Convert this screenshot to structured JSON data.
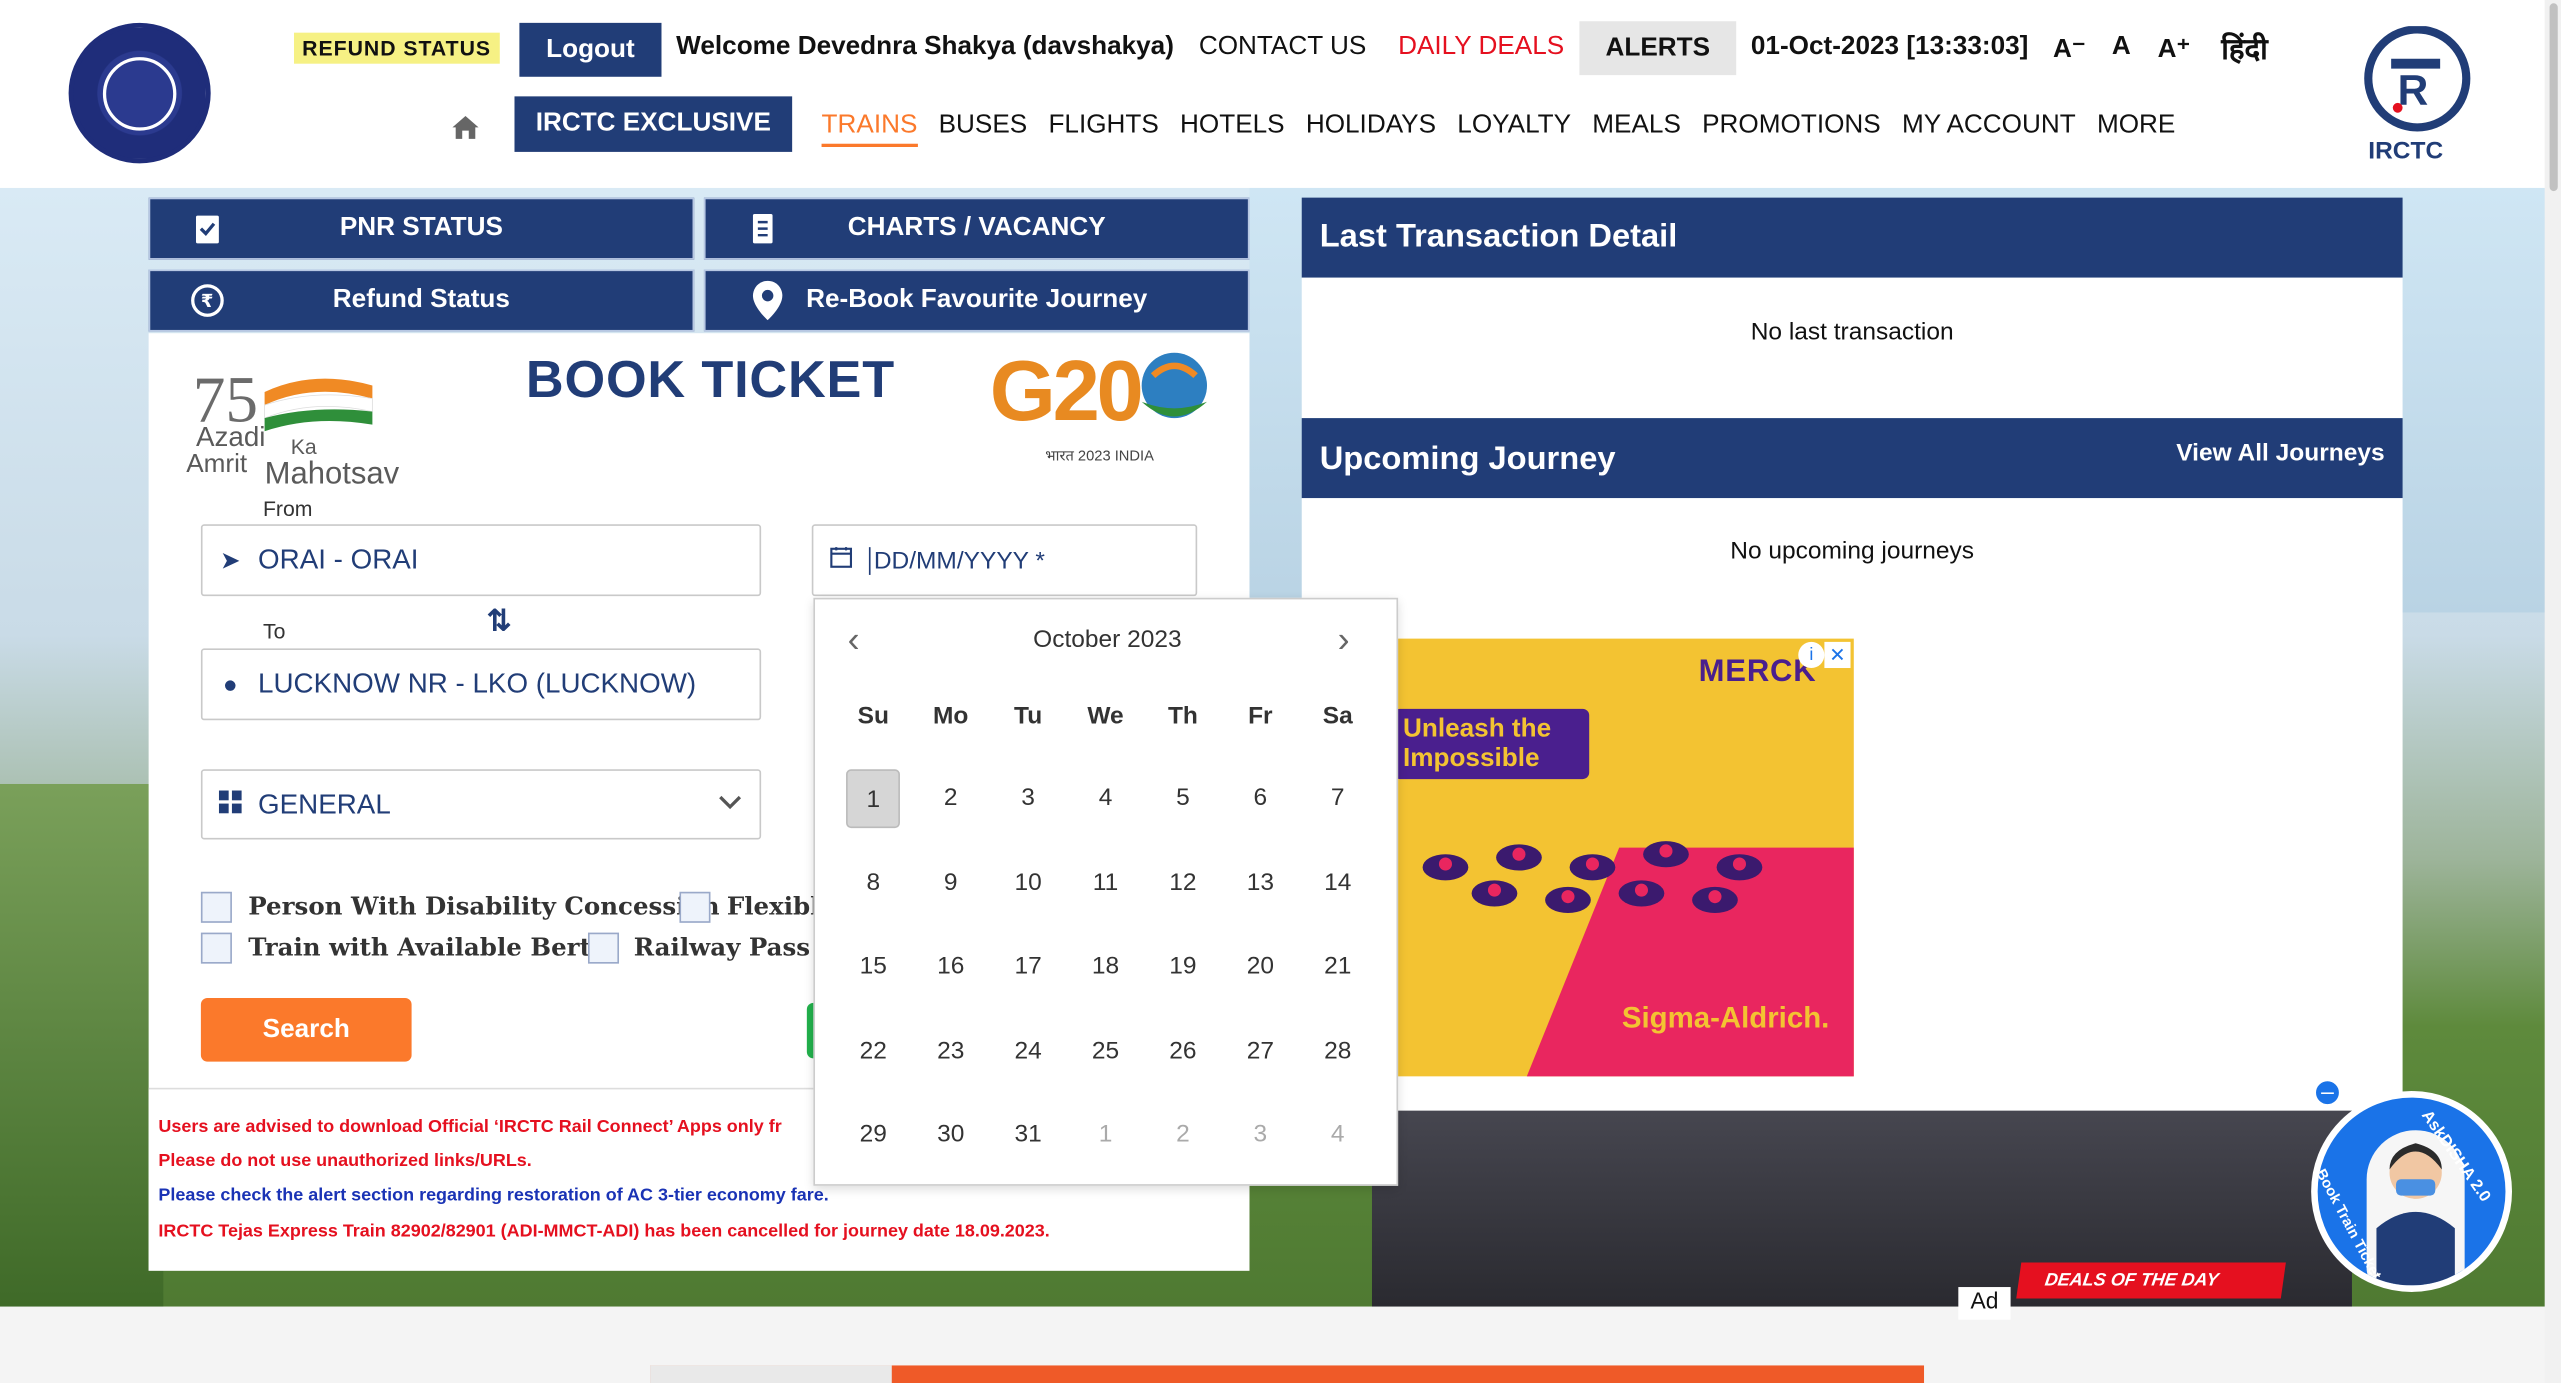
{
  "header": {
    "refund_badge": "REFUND STATUS",
    "logout": "Logout",
    "welcome": "Welcome Devednra Shakya (davshakya)",
    "contact": "CONTACT US",
    "daily_deals": "DAILY DEALS",
    "alerts": "ALERTS",
    "datetime": "01-Oct-2023 [13:33:03]",
    "font_small": "A⁻",
    "font_normal": "A",
    "font_large": "A⁺",
    "hindi": "हिंदी",
    "irctc_logo_text": "IRCTC",
    "exclusive": "IRCTC EXCLUSIVE",
    "nav": [
      "TRAINS",
      "BUSES",
      "FLIGHTS",
      "HOTELS",
      "HOLIDAYS",
      "LOYALTY",
      "MEALS",
      "PROMOTIONS",
      "MY ACCOUNT",
      "MORE"
    ]
  },
  "tiles": {
    "pnr": "PNR STATUS",
    "charts": "CHARTS / VACANCY",
    "refund": "Refund Status",
    "rebook": "Re-Book Favourite Journey"
  },
  "book": {
    "title": "BOOK TICKET",
    "from_label": "From",
    "from_value": "ORAI - ORAI",
    "to_label": "To",
    "to_value": "LUCKNOW NR - LKO (LUCKNOW)",
    "date_placeholder": "DD/MM/YYYY *",
    "quota": "GENERAL",
    "chk_disability": "Person With Disability Concession",
    "chk_flexible": "Flexible",
    "chk_berth": "Train with Available Berth",
    "chk_railpass": "Railway Pass Co",
    "search": "Search",
    "azadi_line1": "Azadi",
    "azadi_ka": "Ka",
    "azadi_line2": "Amrit",
    "azadi_mahotsav": "Mahotsav",
    "g20_text": "G20",
    "g20_sub": "भारत 2023 INDIA"
  },
  "notices": [
    {
      "text": "Users are advised to download Official ‘IRCTC Rail Connect’ Apps only fr",
      "color": "#e5101f"
    },
    {
      "text": "Please do not use unauthorized links/URLs.",
      "color": "#e5101f"
    },
    {
      "text": "Please check the alert section regarding restoration of AC 3-tier economy fare.",
      "color": "#1a33b5"
    },
    {
      "text": "IRCTC Tejas Express Train 82902/82901 (ADI-MMCT-ADI) has been cancelled for journey date 18.09.2023.",
      "color": "#e5101f"
    }
  ],
  "right": {
    "last_title": "Last Transaction Detail",
    "last_empty": "No last transaction",
    "up_title": "Upcoming Journey",
    "up_link": "View All Journeys",
    "up_empty": "No upcoming journeys"
  },
  "ad": {
    "brand": "MERCK",
    "headline_1": "Unleash the",
    "headline_2": "Impossible",
    "sig": "Sigma-Aldrich.",
    "ad_tag": "Ad",
    "deals_day": "DEALS OF THE DAY"
  },
  "datepicker": {
    "month": "October 2023",
    "weekdays": [
      "Su",
      "Mo",
      "Tu",
      "We",
      "Th",
      "Fr",
      "Sa"
    ],
    "weeks": [
      [
        "1",
        "2",
        "3",
        "4",
        "5",
        "6",
        "7"
      ],
      [
        "8",
        "9",
        "10",
        "11",
        "12",
        "13",
        "14"
      ],
      [
        "15",
        "16",
        "17",
        "18",
        "19",
        "20",
        "21"
      ],
      [
        "22",
        "23",
        "24",
        "25",
        "26",
        "27",
        "28"
      ],
      [
        "29",
        "30",
        "31",
        "1",
        "2",
        "3",
        "4"
      ]
    ]
  },
  "disha": {
    "label": "AskDISHA 2.0",
    "sub": "Book Train Ticket"
  }
}
